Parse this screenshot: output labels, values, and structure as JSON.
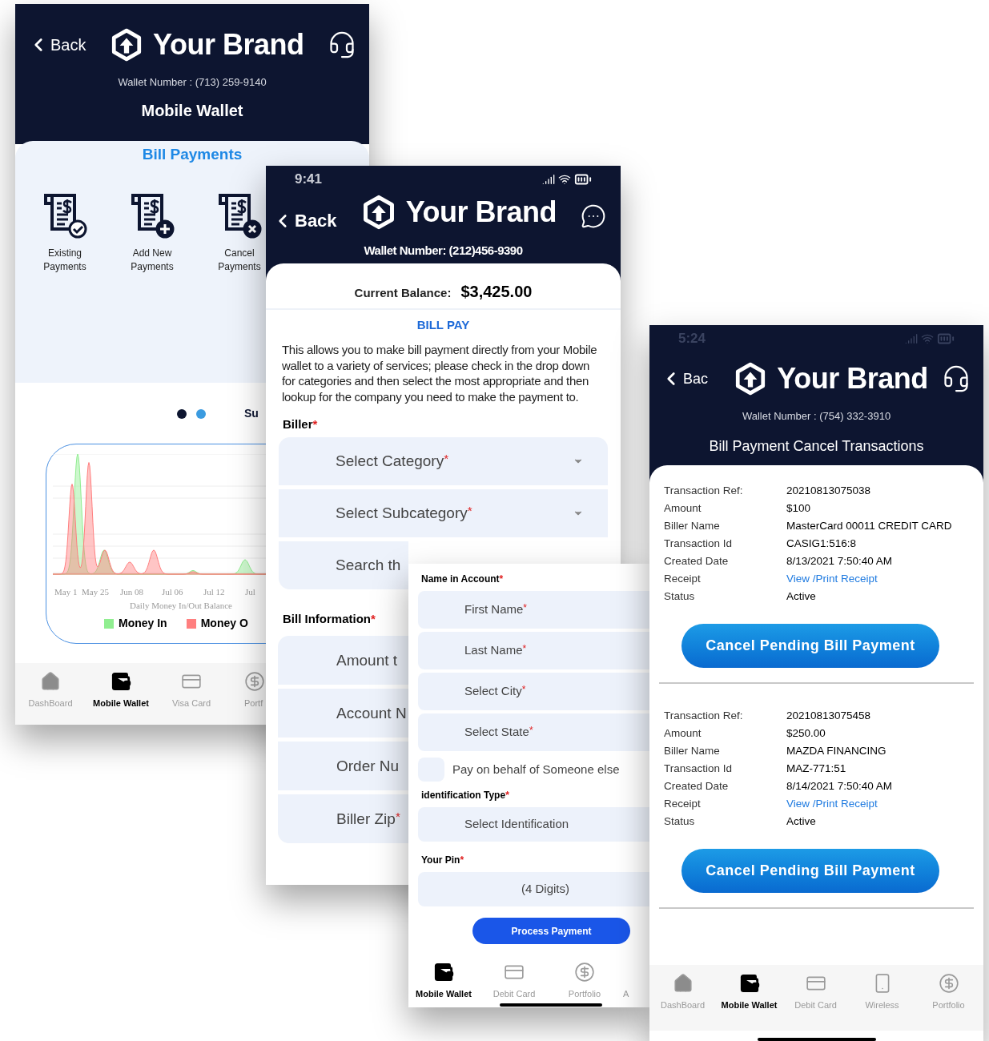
{
  "wallet_screen": {
    "back": "Back",
    "brand": "Your Brand",
    "wallet_number": "Wallet Number : (713) 259-9140",
    "title": "Mobile Wallet",
    "section": "Bill Payments",
    "actions": [
      {
        "label": "Existing Payments"
      },
      {
        "label": "Add New Payments"
      },
      {
        "label": "Cancel Payments"
      }
    ],
    "carousel_dots": [
      {
        "selected": true
      },
      {
        "selected": false
      }
    ],
    "next_card_text": "Su",
    "chart": {
      "x_labels": [
        "May 1",
        "May 25",
        "Jun 08",
        "Jul 06",
        "Jul 12",
        "Jul"
      ],
      "title": "Daily Money In/Out Balance",
      "legend": [
        {
          "label": "Money In",
          "color": "#90ee90"
        },
        {
          "label": "Money O",
          "color": "#ff7f7f"
        }
      ]
    },
    "tabs": [
      {
        "label": "DashBoard",
        "selected": false
      },
      {
        "label": "Mobile Wallet",
        "selected": true
      },
      {
        "label": "Visa Card",
        "selected": false
      },
      {
        "label": "Portf",
        "selected": false
      }
    ]
  },
  "bill_pay_screen": {
    "time": "9:41",
    "back": "Back",
    "brand": "Your Brand",
    "wallet_number": "Wallet Number: (212)456-9390",
    "balance_label": "Current Balance:",
    "balance": "$3,425.00",
    "section": "BILL PAY",
    "description": "This allows you to make bill payment directly from your Mobile wallet to a variety of services; please check in the drop down for categories and then select the most appropriate and then lookup for the company you need to make the payment to.",
    "biller_label": {
      "text": "Biller",
      "mark": "*"
    },
    "biller_fields": [
      {
        "placeholder": "Select Category",
        "mark": "*",
        "kind": "dropdown"
      },
      {
        "placeholder": "Select Subcategory",
        "mark": "*",
        "kind": "dropdown"
      },
      {
        "placeholder": "Search th",
        "kind": "input"
      }
    ],
    "bill_info_label": {
      "text": "Bill Information",
      "mark": "*"
    },
    "bill_fields": [
      {
        "placeholder": "Amount t"
      },
      {
        "placeholder": "Account N"
      },
      {
        "placeholder": "Order Nu"
      },
      {
        "placeholder": "Biller Zip",
        "mark": "*"
      }
    ]
  },
  "payee_screen": {
    "name_label": {
      "text": "Name in Account",
      "mark": "*"
    },
    "fields": [
      {
        "placeholder": "First Name",
        "mark": "*"
      },
      {
        "placeholder": "Last Name",
        "mark": "*"
      },
      {
        "placeholder": "Select City",
        "mark": "*"
      },
      {
        "placeholder": "Select State",
        "mark": "*"
      }
    ],
    "checkbox": {
      "label": "Pay on behalf of Someone else",
      "checked": false
    },
    "id_label": {
      "text": "identification Type",
      "mark": "*"
    },
    "id_field": {
      "placeholder": "Select Identification"
    },
    "pin_label": {
      "text": "Your Pin",
      "mark": "*"
    },
    "pin_field": {
      "placeholder": "(4 Digits)"
    },
    "button": "Process Payment",
    "tabs": [
      {
        "label": "Mobile Wallet",
        "selected": true
      },
      {
        "label": "Debit Card",
        "selected": false
      },
      {
        "label": "Portfolio",
        "selected": false
      },
      {
        "label": "A",
        "selected": false
      }
    ]
  },
  "cancel_screen": {
    "time": "5:24",
    "back": "Bac",
    "brand": "Your Brand",
    "wallet_number": "Wallet Number : (754) 332-3910",
    "title": "Bill Payment Cancel Transactions",
    "transactions": [
      {
        "rows": [
          {
            "label": "Transaction Ref:",
            "value": "20210813075038",
            "kind": "text"
          },
          {
            "label": "Amount",
            "value": "$100",
            "kind": "text"
          },
          {
            "label": "Biller Name",
            "value": "MasterCard 00011 CREDIT CARD",
            "kind": "text"
          },
          {
            "label": "Transaction Id",
            "value": "CASIG1:516:8",
            "kind": "text"
          },
          {
            "label": "Created Date",
            "value": "8/13/2021 7:50:40 AM",
            "kind": "text"
          },
          {
            "label": "Receipt",
            "value": "View /Print Receipt",
            "kind": "link"
          },
          {
            "label": "Status",
            "value": "Active",
            "kind": "text"
          }
        ],
        "button": "Cancel Pending Bill Payment"
      },
      {
        "rows": [
          {
            "label": "Transaction Ref:",
            "value": "20210813075458",
            "kind": "text"
          },
          {
            "label": "Amount",
            "value": "$250.00",
            "kind": "text"
          },
          {
            "label": "Biller Name",
            "value": "MAZDA FINANCING",
            "kind": "text"
          },
          {
            "label": "Transaction Id",
            "value": "MAZ-771:51",
            "kind": "text"
          },
          {
            "label": "Created Date",
            "value": "8/14/2021 7:50:40 AM",
            "kind": "text"
          },
          {
            "label": "Receipt",
            "value": "View /Print Receipt",
            "kind": "link"
          },
          {
            "label": "Status",
            "value": "Active",
            "kind": "text"
          }
        ],
        "button": "Cancel Pending Bill Payment"
      }
    ],
    "tabs": [
      {
        "label": "DashBoard",
        "selected": false
      },
      {
        "label": "Mobile Wallet",
        "selected": true
      },
      {
        "label": "Debit Card",
        "selected": false
      },
      {
        "label": "Wireless",
        "selected": false
      },
      {
        "label": "Portfolio",
        "selected": false
      }
    ]
  }
}
